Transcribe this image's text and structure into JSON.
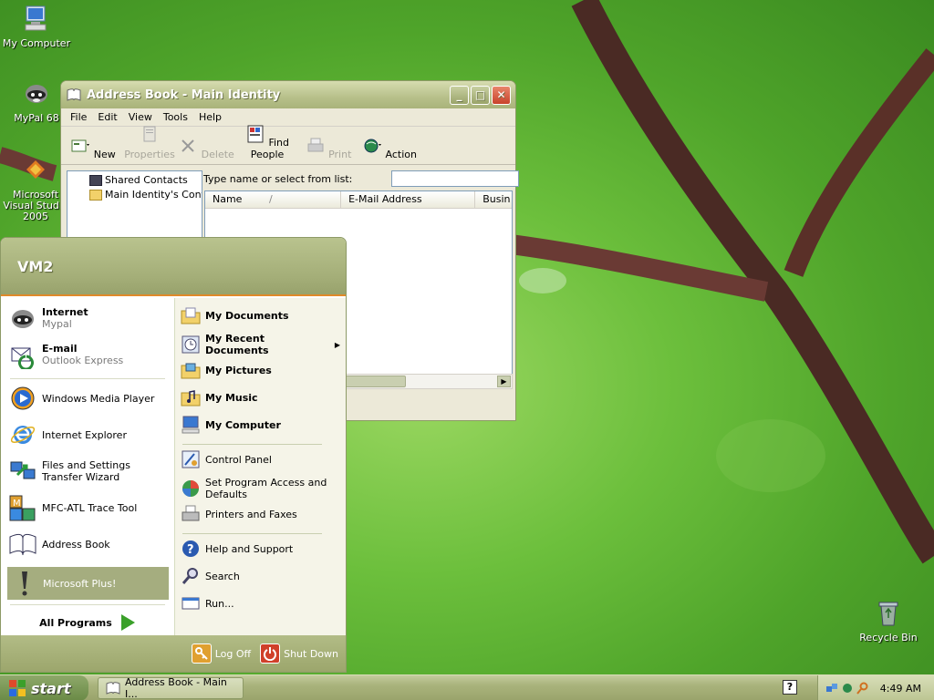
{
  "desktop": {
    "icons": [
      {
        "label": "My Computer"
      },
      {
        "label": "MyPal 68"
      },
      {
        "label": "Microsoft Visual Studio 2005"
      },
      {
        "label": "Recycle Bin"
      }
    ]
  },
  "window": {
    "title": "Address Book - Main Identity",
    "menu": [
      "File",
      "Edit",
      "View",
      "Tools",
      "Help"
    ],
    "toolbar": [
      {
        "label": "New",
        "enabled": true
      },
      {
        "label": "Properties",
        "enabled": false
      },
      {
        "label": "Delete",
        "enabled": false
      },
      {
        "label": "Find People",
        "enabled": true
      },
      {
        "label": "Print",
        "enabled": false
      },
      {
        "label": "Action",
        "enabled": true
      }
    ],
    "tree": [
      "Shared Contacts",
      "Main Identity's Conta"
    ],
    "search_label": "Type name or select from list:",
    "search_value": "",
    "columns": [
      "Name",
      "E-Mail Address",
      "Busin"
    ]
  },
  "startmenu": {
    "user": "VM2",
    "pinned": [
      {
        "title": "Internet",
        "sub": "Mypal"
      },
      {
        "title": "E-mail",
        "sub": "Outlook Express"
      }
    ],
    "recent": [
      "Windows Media Player",
      "Internet Explorer",
      "Files and Settings Transfer Wizard",
      "MFC-ATL Trace Tool",
      "Address Book",
      "Microsoft Plus!"
    ],
    "all_programs": "All Programs",
    "right": [
      "My Documents",
      "My Recent Documents",
      "My Pictures",
      "My Music",
      "My Computer",
      "Control Panel",
      "Set Program Access and Defaults",
      "Printers and Faxes",
      "Help and Support",
      "Search",
      "Run..."
    ],
    "logoff": "Log Off",
    "shutdown": "Shut Down"
  },
  "taskbar": {
    "start": "start",
    "task": "Address Book - Main I...",
    "time": "4:49 AM"
  },
  "colors": {
    "accent": "#e08a2a",
    "title_olive": "#a9b37a",
    "highlight": "#a5ad7f"
  }
}
